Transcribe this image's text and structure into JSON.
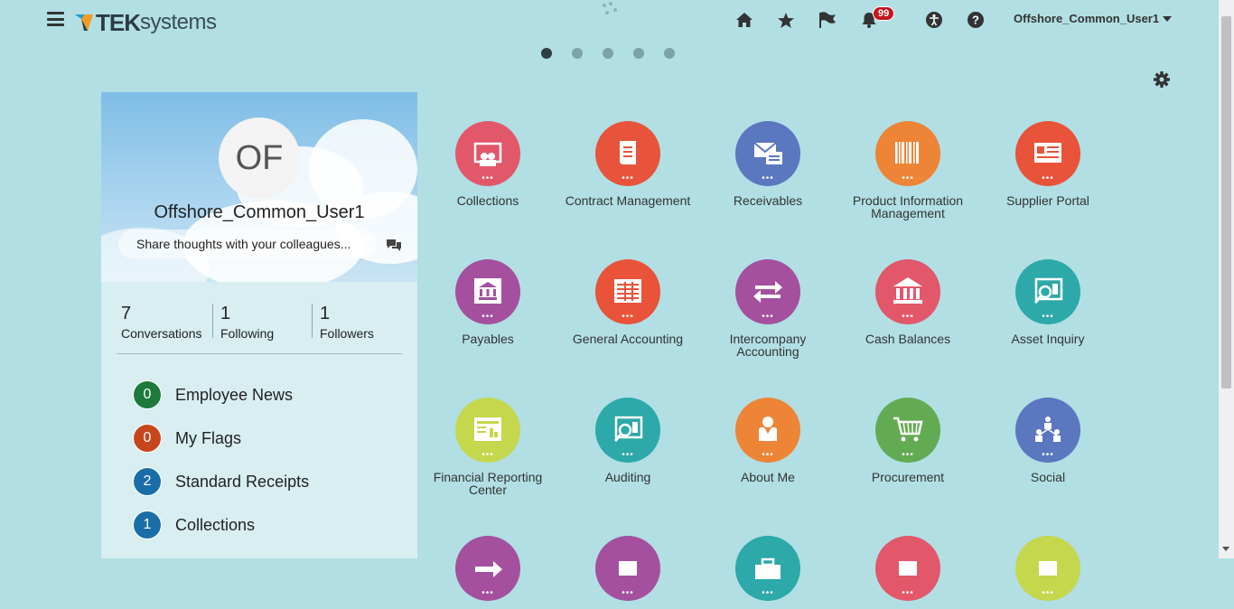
{
  "header": {
    "logo_text_bold": "TEK",
    "logo_text_light": "systems",
    "notification_count": "99",
    "user_name": "Offshore_Common_User1"
  },
  "pager": {
    "pages": 5,
    "active": 1
  },
  "profile": {
    "initials": "OF",
    "name": "Offshore_Common_User1",
    "share_placeholder": "Share thoughts with your colleagues...",
    "stats": [
      {
        "count": "7",
        "label": "Conversations"
      },
      {
        "count": "1",
        "label": "Following"
      },
      {
        "count": "1",
        "label": "Followers"
      }
    ],
    "watchlist": [
      {
        "count": "0",
        "label": "Employee News",
        "color": "#1d7a3a"
      },
      {
        "count": "0",
        "label": "My Flags",
        "color": "#c6461b"
      },
      {
        "count": "2",
        "label": "Standard Receipts",
        "color": "#1a6ea8"
      },
      {
        "count": "1",
        "label": "Collections",
        "color": "#1a6ea8"
      }
    ]
  },
  "apps": [
    {
      "label": "Collections",
      "color": "#e2576a",
      "icon": "collections-icon"
    },
    {
      "label": "Contract Management",
      "color": "#e7543b",
      "icon": "contract-icon"
    },
    {
      "label": "Receivables",
      "color": "#5a77bf",
      "icon": "receivables-icon"
    },
    {
      "label": "Product Information Management",
      "color": "#ee8436",
      "icon": "barcode-icon"
    },
    {
      "label": "Supplier Portal",
      "color": "#e8533a",
      "icon": "supplier-portal-icon"
    },
    {
      "label": "Payables",
      "color": "#a4509e",
      "icon": "payables-icon"
    },
    {
      "label": "General Accounting",
      "color": "#e8533a",
      "icon": "ledger-icon"
    },
    {
      "label": "Intercompany Accounting",
      "color": "#a4509e",
      "icon": "transfer-arrows-icon"
    },
    {
      "label": "Cash Balances",
      "color": "#e2576a",
      "icon": "bank-icon"
    },
    {
      "label": "Asset Inquiry",
      "color": "#2ca9a8",
      "icon": "asset-inquiry-icon"
    },
    {
      "label": "Financial Reporting Center",
      "color": "#c4d74d",
      "icon": "report-icon"
    },
    {
      "label": "Auditing",
      "color": "#2ca9a8",
      "icon": "auditing-icon"
    },
    {
      "label": "About Me",
      "color": "#ee8436",
      "icon": "person-icon"
    },
    {
      "label": "Procurement",
      "color": "#63ab52",
      "icon": "cart-icon"
    },
    {
      "label": "Social",
      "color": "#5a77bf",
      "icon": "social-network-icon"
    },
    {
      "label": "",
      "color": "#a4509e",
      "icon": "arrow-icon"
    },
    {
      "label": "",
      "color": "#a4509e",
      "icon": "app-icon"
    },
    {
      "label": "",
      "color": "#2ca9a8",
      "icon": "briefcase-icon"
    },
    {
      "label": "",
      "color": "#e2576a",
      "icon": "app-icon"
    },
    {
      "label": "",
      "color": "#c4d74d",
      "icon": "app-icon"
    }
  ]
}
